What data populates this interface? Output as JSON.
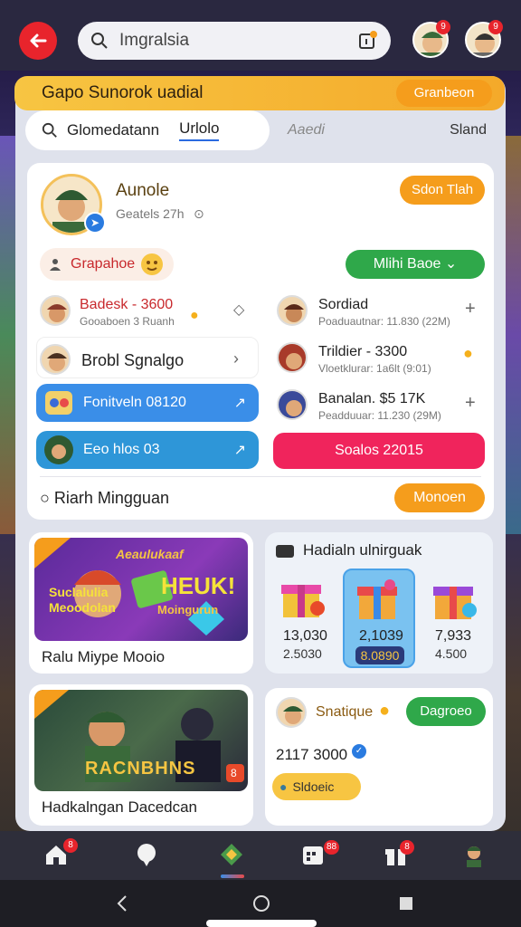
{
  "search": {
    "query": "Imgralsia"
  },
  "header": {
    "avatar_badge_1": "9",
    "avatar_badge_2": "9"
  },
  "banner": {
    "title": "Gapo Sunorok uadial",
    "button": "Granbeon"
  },
  "tabs": {
    "tab1": "Glomedatann",
    "tab2": "Urlolo",
    "tab3": "Aaedi",
    "tab4": "Sland"
  },
  "profile": {
    "name": "Aunole",
    "subtitle": "Geatels 27h",
    "follow_button": "Sdon Tlah",
    "chip_label": "Grapahoe",
    "dropdown": "Mlihi Baoe"
  },
  "list_left": [
    {
      "title": "Badesk - 3600",
      "subtitle": "Gooaboen 3 Ruanh"
    },
    {
      "title": "Brobl Sgnalgo"
    }
  ],
  "pills": {
    "blue": "Fonitveln 08120",
    "teal": "Eeo hlos 03"
  },
  "list_right": [
    {
      "title": "Sordiad",
      "subtitle": "Poaduautnar: 11.830 (22M)"
    },
    {
      "title": "Trildier - 3300",
      "subtitle": "Vloetklurar: 1a6lt (9:01)"
    },
    {
      "title": "Banalan. $5 17K",
      "subtitle": "Peadduuar: 11.230 (29M)"
    }
  ],
  "red_button": "Soalos 22015",
  "footer": {
    "label": "Riarh Mingguan",
    "button": "Monoen"
  },
  "game1": {
    "art_title": "HEUK!",
    "art_top": "Aeaulukaaf",
    "art_side": "Suclalulia Meoodolan",
    "art_bottom": "Moingurun",
    "label": "Ralu Miype Mooio"
  },
  "weekly": {
    "title": "Hadialn ulnirguak",
    "items": [
      {
        "value": "13,030",
        "sub": "2.5030"
      },
      {
        "value": "2,1039",
        "sub": "8.0890"
      },
      {
        "value": "7,933",
        "sub": "4.500"
      }
    ]
  },
  "game2": {
    "art_title": "RACNBHNS",
    "label": "Hadkalngan Dacedcan",
    "badge": "8"
  },
  "social": {
    "name": "Snatique",
    "button": "Dagroeo",
    "amount": "2117 3000",
    "chip": "Sldoeic"
  },
  "bottom_nav": {
    "badge1": "8",
    "badge2": "88",
    "badge3": "8"
  }
}
